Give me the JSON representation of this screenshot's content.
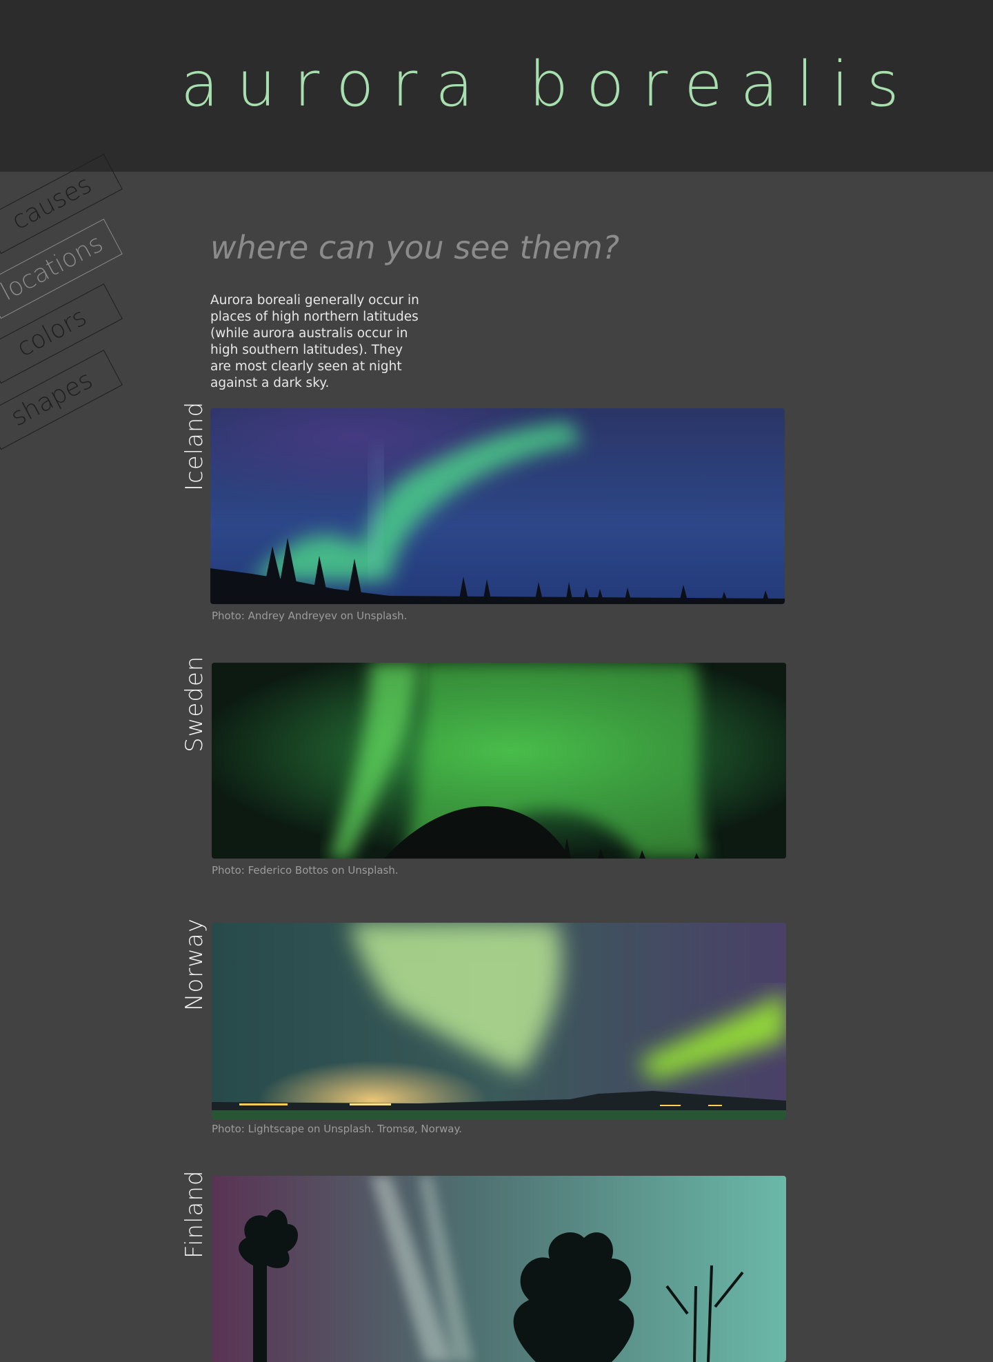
{
  "header": {
    "title": "aurora borealis",
    "title_color": "#a8dfae",
    "background": "#2c2c2c"
  },
  "nav": {
    "items": [
      {
        "label": "causes",
        "active": false
      },
      {
        "label": "locations",
        "active": true
      },
      {
        "label": "colors",
        "active": false
      },
      {
        "label": "shapes",
        "active": false
      }
    ]
  },
  "section": {
    "heading": "where can you see them?",
    "intro": "Aurora boreali generally occur in places of high northern latitudes (while aurora australis occur in high southern latitudes). They are most clearly seen at night against a dark sky."
  },
  "locations": [
    {
      "country": "Iceland",
      "caption": "Photo: Andrey Andreyev on Unsplash.",
      "photo": "aurora-iceland-image"
    },
    {
      "country": "Sweden",
      "caption": "Photo: Federico Bottos on Unsplash.",
      "photo": "aurora-sweden-image"
    },
    {
      "country": "Norway",
      "caption": "Photo: Lightscape on Unsplash. Tromsø, Norway.",
      "photo": "aurora-norway-image"
    },
    {
      "country": "Finland",
      "caption": "",
      "photo": "aurora-finland-image"
    }
  ],
  "colors": {
    "page_background": "#424242",
    "text_light": "#f3f3f3",
    "caption": "#9c9c9c",
    "heading": "#8b8b8b"
  }
}
